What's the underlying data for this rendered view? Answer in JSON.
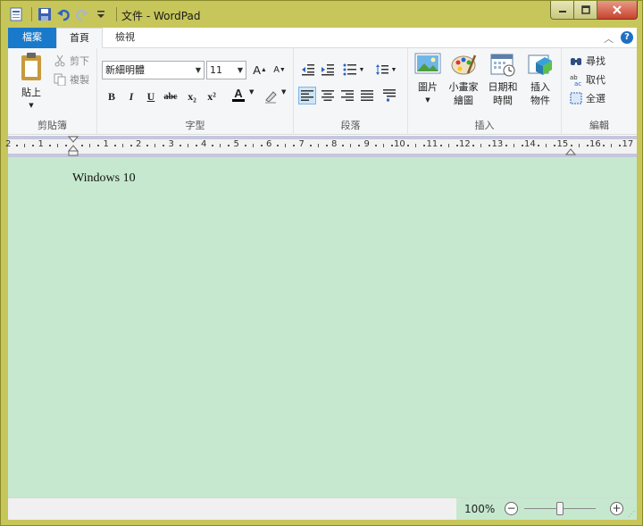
{
  "window": {
    "title": "文件 - WordPad",
    "qat_icons": [
      "wordpad-app-icon",
      "save-icon",
      "undo-icon",
      "redo-icon",
      "customize-qat-icon"
    ],
    "controls": [
      "minimize-icon",
      "maximize-icon",
      "close-icon"
    ]
  },
  "tabs": [
    {
      "label": "檔案"
    },
    {
      "label": "首頁"
    },
    {
      "label": "檢視"
    }
  ],
  "ribbon": {
    "clipboard": {
      "label": "剪貼簿",
      "paste": "貼上",
      "cut": "剪下",
      "copy": "複製"
    },
    "font": {
      "label": "字型",
      "family": "新細明體",
      "size": "11",
      "bold": "B",
      "italic": "I",
      "underline": "U",
      "strike": "abc",
      "subscript": "x₂",
      "superscript": "x²",
      "color_letter": "A",
      "font_color": "#000000",
      "grow": "A",
      "shrink": "A"
    },
    "paragraph": {
      "label": "段落",
      "align_selected": "left"
    },
    "insert": {
      "label": "插入",
      "picture": "圖片",
      "paint_line1": "小畫家",
      "paint_line2": "繪圖",
      "datetime_line1": "日期和",
      "datetime_line2": "時間",
      "object_line1": "插入",
      "object_line2": "物件"
    },
    "editing": {
      "label": "編輯",
      "find": "尋找",
      "replace": "取代",
      "select_all": "全選"
    }
  },
  "ruler": {
    "numbers": [
      "2",
      "1",
      "1",
      "2",
      "3",
      "4",
      "5",
      "6",
      "7",
      "8",
      "9",
      "10",
      "11",
      "12",
      "13",
      "14",
      "15",
      "16",
      "17"
    ]
  },
  "document": {
    "text": "Windows 10",
    "background": "#c6e8cf"
  },
  "status": {
    "zoom": "100%",
    "zoom_fraction": 0.5,
    "zoom_out": "−",
    "zoom_in": "+"
  }
}
